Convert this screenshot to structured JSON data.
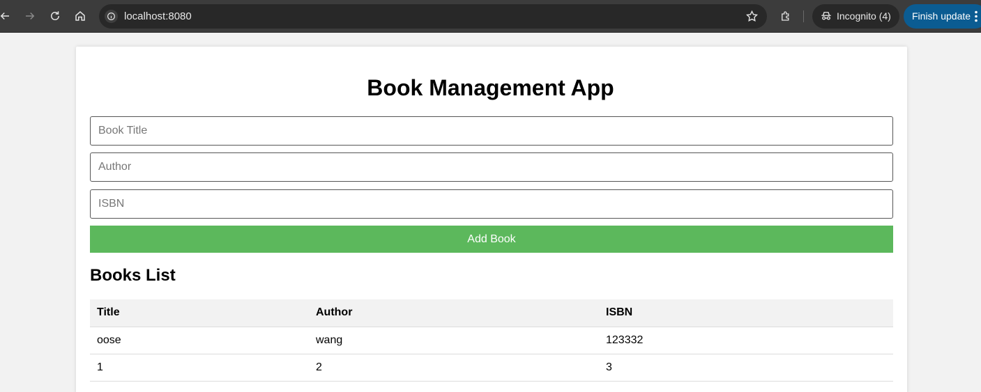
{
  "browser": {
    "url": "localhost:8080",
    "incognito_label": "Incognito (4)",
    "finish_update_label": "Finish update",
    "icons": [
      "back-arrow-icon",
      "forward-arrow-icon",
      "reload-icon",
      "home-icon",
      "site-info-icon",
      "bookmark-star-icon",
      "extensions-icon",
      "incognito-icon",
      "more-menu-icon"
    ]
  },
  "app": {
    "title": "Book Management App",
    "form": {
      "title_placeholder": "Book Title",
      "author_placeholder": "Author",
      "isbn_placeholder": "ISBN",
      "title_value": "",
      "author_value": "",
      "isbn_value": "",
      "add_button_label": "Add Book"
    },
    "list": {
      "heading": "Books List",
      "columns": [
        "Title",
        "Author",
        "ISBN"
      ],
      "rows": [
        {
          "title": "oose",
          "author": "wang",
          "isbn": "123332"
        },
        {
          "title": "1",
          "author": "2",
          "isbn": "3"
        }
      ]
    }
  },
  "colors": {
    "add_button": "#5cb85c",
    "finish_update_button": "#0b5c92",
    "toolbar": "#3c3c3c",
    "table_header": "#f2f2f2"
  }
}
